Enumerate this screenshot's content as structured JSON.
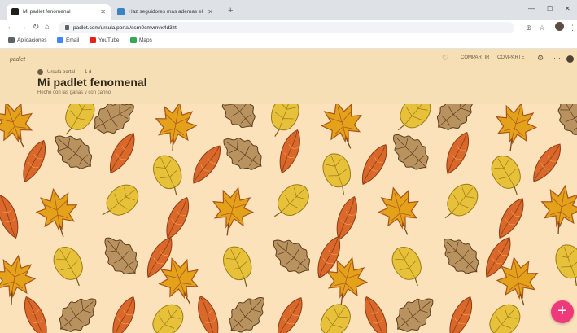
{
  "browser": {
    "tabs": [
      {
        "title": "Mi padlet fenomenal",
        "active": true,
        "favicon_color": "#1f1f1f"
      },
      {
        "title": "Haz seguidores mas ademas el...",
        "active": false,
        "favicon_color": "#3b82c4"
      }
    ],
    "url": "padlet.com/ursula.portal/ssrn0cmvmvx4d3zt",
    "bookmarks": [
      {
        "label": "Aplicaciones",
        "icon": "apps-grid-icon",
        "color": "#5f6368"
      },
      {
        "label": "Email",
        "icon": "mail-icon",
        "color": "#4285f4"
      },
      {
        "label": "YouTube",
        "icon": "youtube-icon",
        "color": "#e62117"
      },
      {
        "label": "Maps",
        "icon": "maps-icon",
        "color": "#34a853"
      }
    ]
  },
  "padlet": {
    "brand": "padlet",
    "author": "Ursula portal",
    "age": "1 d",
    "title": "Mi padlet fenomenal",
    "subtitle": "Hecho con las ganas y con cariño",
    "actions": {
      "like": "♡",
      "share": "COMPARTIR",
      "remake": "COMPARTE",
      "settings": "⚙",
      "more": "⋯"
    },
    "add_button": "+"
  },
  "colors": {
    "header_bg": "#f6dfb5",
    "wallpaper_bg": "#fbe2ba",
    "fab": "#f0397a"
  }
}
